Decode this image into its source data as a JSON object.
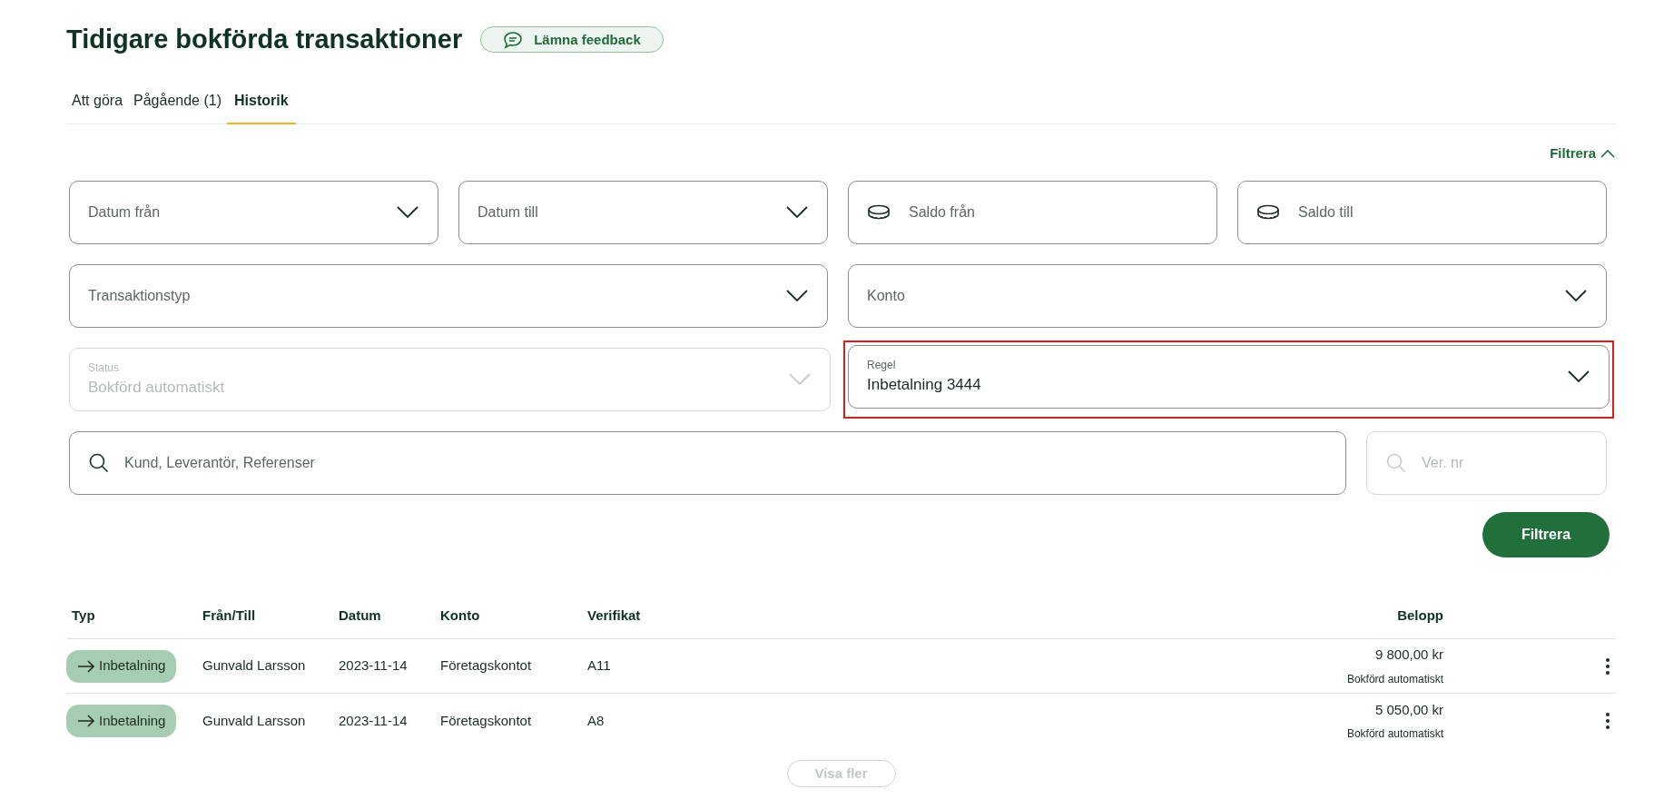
{
  "page_title": "Tidigare bokförda transaktioner",
  "feedback_button": "Lämna feedback",
  "tabs": [
    {
      "label": "Att göra",
      "selected": false
    },
    {
      "label": "Pågående (1)",
      "selected": false
    },
    {
      "label": "Historik",
      "selected": true
    }
  ],
  "filter_toggle": {
    "label": "Filtrera",
    "expanded": true
  },
  "filter_rows": [
    [
      {
        "kind": "dropdown",
        "placeholder": "Datum från"
      },
      {
        "kind": "dropdown",
        "placeholder": "Datum till"
      },
      {
        "kind": "amount",
        "placeholder": "Saldo från"
      },
      {
        "kind": "amount",
        "placeholder": "Saldo till"
      }
    ],
    [
      {
        "kind": "dropdown",
        "placeholder": "Transaktionstyp"
      },
      {
        "kind": "dropdown",
        "placeholder": "Konto"
      }
    ],
    [
      {
        "kind": "dropdown",
        "label": "Status",
        "value": "Bokförd automatiskt",
        "disabled": true,
        "highlighted": false
      },
      {
        "kind": "dropdown",
        "label": "Regel",
        "value": "Inbetalning 3444",
        "disabled": false,
        "highlighted": true
      }
    ],
    [
      {
        "kind": "search",
        "placeholder": "Kund, Leverantör, Referenser",
        "disabled": false
      },
      {
        "kind": "search",
        "placeholder": "Ver. nr",
        "disabled": true
      }
    ]
  ],
  "filter_button": "Filtrera",
  "table": {
    "columns": [
      "Typ",
      "Från/Till",
      "Datum",
      "Konto",
      "Verifikat",
      "Belopp"
    ],
    "rows": [
      {
        "type": "Inbetalning",
        "party": "Gunvald Larsson",
        "date": "2023-11-14",
        "account": "Företagskontot",
        "voucher": "A11",
        "amount": "9 800,00 kr",
        "status": "Bokförd automatiskt"
      },
      {
        "type": "Inbetalning",
        "party": "Gunvald Larsson",
        "date": "2023-11-14",
        "account": "Företagskontot",
        "voucher": "A8",
        "amount": "5 050,00 kr",
        "status": "Bokförd automatiskt"
      }
    ]
  },
  "show_more": {
    "label": "Visa fler",
    "disabled": true
  }
}
